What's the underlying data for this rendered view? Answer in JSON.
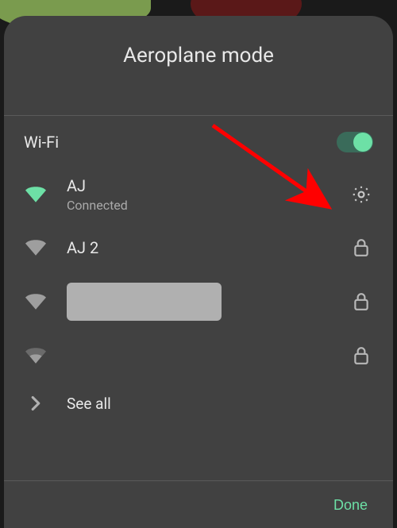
{
  "header": {
    "title": "Aeroplane mode"
  },
  "wifi": {
    "section_title": "Wi-Fi",
    "toggle_on": true,
    "networks": [
      {
        "name": "AJ",
        "status": "Connected",
        "signal": "full",
        "connected": true,
        "action_icon": "gear"
      },
      {
        "name": "AJ 2",
        "status": "",
        "signal": "full",
        "connected": false,
        "action_icon": "lock"
      },
      {
        "name": "",
        "redacted": true,
        "signal": "full",
        "connected": false,
        "action_icon": "lock"
      },
      {
        "name": "",
        "redacted": false,
        "signal": "low",
        "connected": false,
        "action_icon": "lock"
      }
    ],
    "see_all_label": "See all"
  },
  "footer": {
    "done_label": "Done"
  },
  "colors": {
    "accent": "#6de0a6",
    "panel_bg": "#414141",
    "text_primary": "#e8e8e8",
    "text_secondary": "#aaa"
  }
}
